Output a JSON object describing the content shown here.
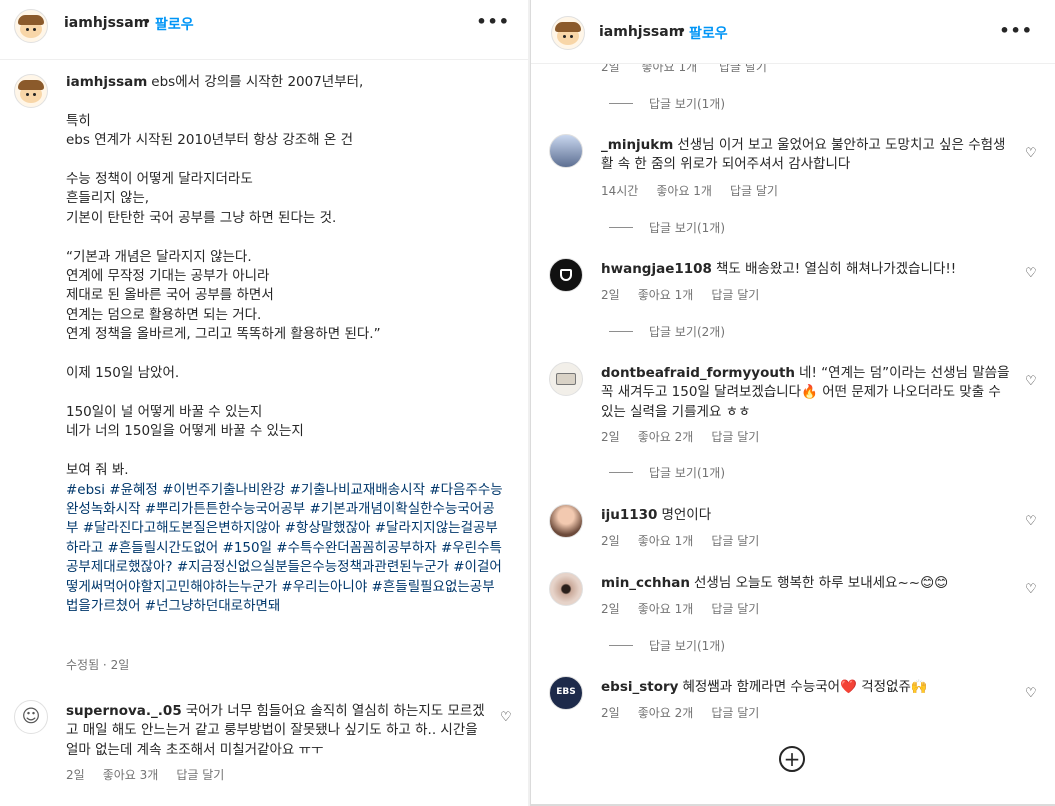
{
  "post": {
    "username": "iamhjssam",
    "follow_label": "팔로우",
    "more_icon": "more-horizontal-icon",
    "caption_text": "ebs에서 강의를 시작한 2007년부터,\n\n특히\nebs 연계가 시작된 2010년부터 항상 강조해 온 건\n\n수능 정책이 어떻게 달라지더라도\n흔들리지 않는,\n기본이 탄탄한 국어 공부를 그냥 하면 된다는 것.\n\n“기본과 개념은 달라지지 않는다.\n연계에 무작정 기대는 공부가 아니라\n제대로 된 올바른 국어 공부를 하면서\n연계는 덤으로 활용하면 되는 거다.\n연계 정책을 올바르게, 그리고 똑똑하게 활용하면 된다.”\n\n이제 150일 남았어.\n\n150일이 널 어떻게 바꿀 수 있는지\n네가 너의 150일을 어떻게 바꿀 수 있는지\n\n보여 줘 봐.\n",
    "hashtags": "#ebsi #윤혜정 #이번주기출나비완강 #기출나비교재배송시작 #다음주수능완성녹화시작 #뿌리가튼튼한수능국어공부 #기본과개념이확실한수능국어공부 #달라진다고해도본질은변하지않아 #항상말했잖아 #달라지지않는걸공부하라고 #흔들릴시간도없어 #150일 #수특수완더꼼꼼히공부하자 #우린수특공부제대로했잖아? #지금정신없으실분들은수능정책과관련된누군가 #이걸어떻게써먹어야할지고민해야하는누군가 #우리는아니야 #흔들릴필요없는공부법을가르쳤어 #넌그냥하던대로하면돼",
    "edited_label": "수정됨 · 2일"
  },
  "left_comments": [
    {
      "user": "supernova._.05",
      "text": "국어가 너무 힘들어요 솔직히 열심히 하는지도 모르겠고 매일 해도 안느는거 같고 룽부방법이 잘못됐나 싶기도 하고 하.. 시간을 얼마 없는데 계속 초조해서 미칠거같아요 ㅠㅜ",
      "time": "2일",
      "likes": "좋아요 3개",
      "reply": "답글 달기"
    }
  ],
  "right_header": {
    "username": "iamhjssam",
    "follow_label": "팔로우"
  },
  "right_top_partial": {
    "time": "2일",
    "likes": "좋아요 1개",
    "reply": "답글 달기",
    "view_replies": "답글 보기(1개)"
  },
  "right_comments": [
    {
      "user": "_minjukm",
      "text": "선생님 이거 보고 울었어요 불안하고 도망치고 싶은 수험생활 속 한 줌의 위로가 되어주셔서 감사합니다",
      "time": "14시간",
      "likes": "좋아요 1개",
      "reply": "답글 달기",
      "view_replies": "답글 보기(1개)"
    },
    {
      "user": "hwangjae1108",
      "text": "책도 배송왔고! 열심히 해쳐나가겠습니다!!",
      "time": "2일",
      "likes": "좋아요 1개",
      "reply": "답글 달기",
      "view_replies": "답글 보기(2개)"
    },
    {
      "user": "dontbeafraid_formyyouth",
      "text": "네! “연계는 덤”이라는 선생님 말씀을 꼭 새겨두고 150일 달려보겠습니다🔥 어떤 문제가 나오더라도 맞출 수 있는 실력을 기를게요 ㅎㅎ",
      "time": "2일",
      "likes": "좋아요 2개",
      "reply": "답글 달기",
      "view_replies": "답글 보기(1개)"
    },
    {
      "user": "iju1130",
      "text": "명언이다",
      "time": "2일",
      "likes": "좋아요 1개",
      "reply": "답글 달기"
    },
    {
      "user": "min_cchhan",
      "text": "선생님 오늘도 행복한 하루 보내세요~~😊😊",
      "time": "2일",
      "likes": "좋아요 1개",
      "reply": "답글 달기",
      "view_replies": "답글 보기(1개)"
    },
    {
      "user": "ebsi_story",
      "text": "혜정쌤과 함께라면 수능국어❤️ 걱정없쥬🙌",
      "time": "2일",
      "likes": "좋아요 2개",
      "reply": "답글 달기"
    }
  ],
  "icons": {
    "heart": "♡",
    "add": "+"
  }
}
